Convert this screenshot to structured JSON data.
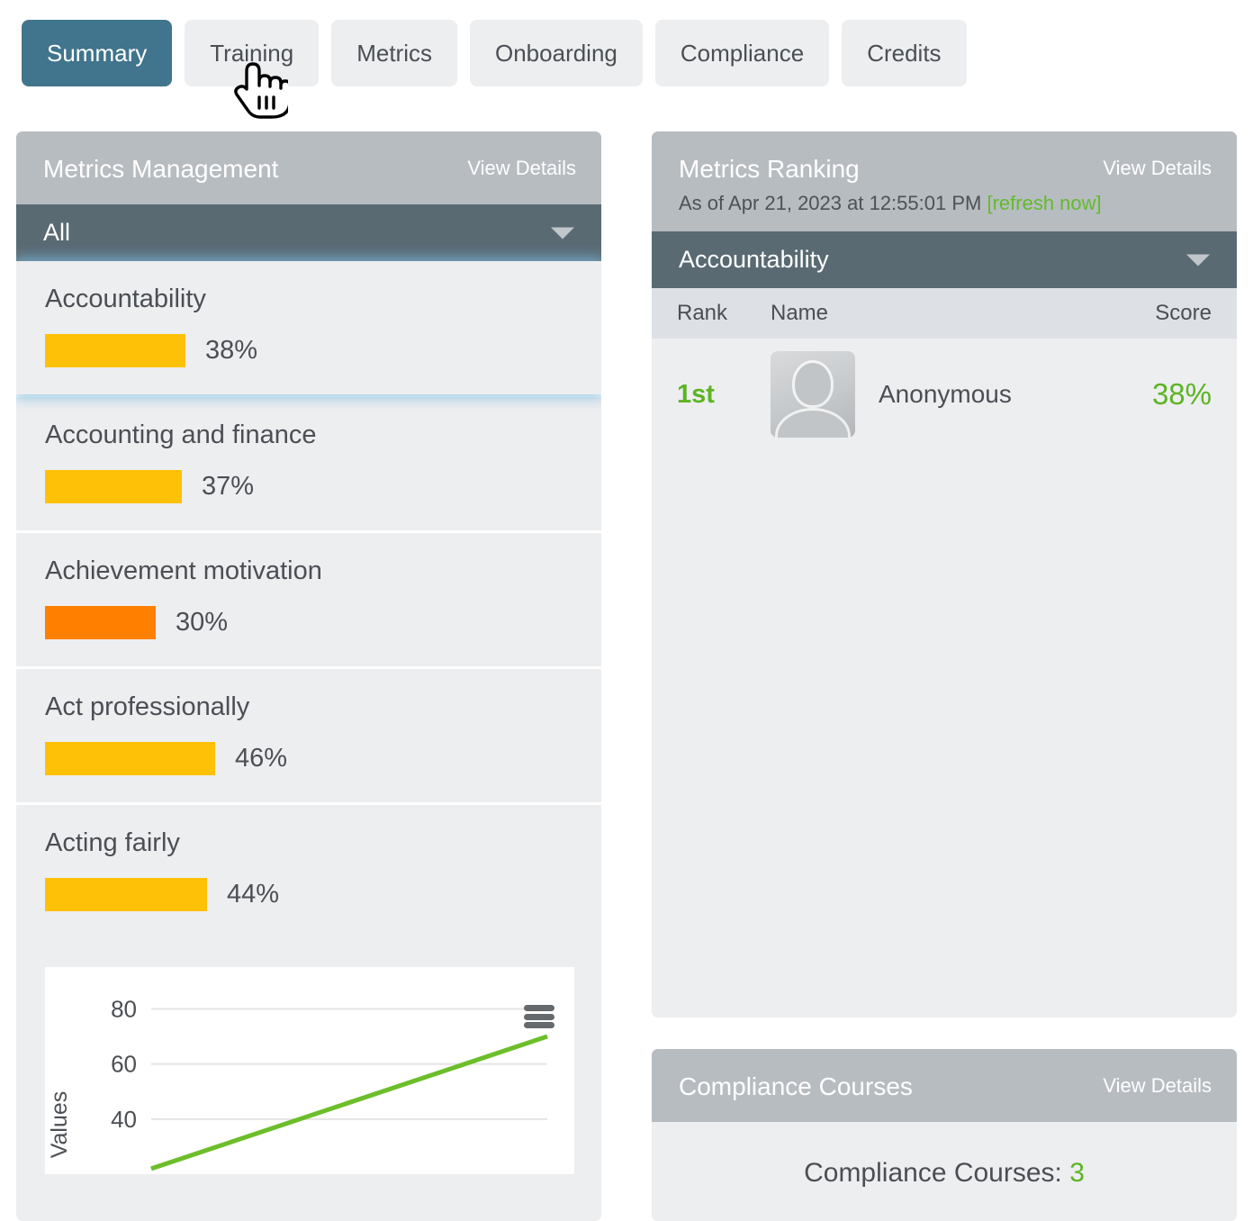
{
  "tabs": [
    {
      "label": "Summary",
      "active": true
    },
    {
      "label": "Training",
      "active": false
    },
    {
      "label": "Metrics",
      "active": false
    },
    {
      "label": "Onboarding",
      "active": false
    },
    {
      "label": "Compliance",
      "active": false
    },
    {
      "label": "Credits",
      "active": false
    }
  ],
  "cursor": {
    "icon": "pointing-hand-cursor",
    "over_tab": "Training"
  },
  "metrics_panel": {
    "title": "Metrics Management",
    "view_details": "View Details",
    "filter_value": "All",
    "items": [
      {
        "name": "Accountability",
        "pct_label": "38%",
        "pct": 38,
        "color": "#ffc107",
        "selected": true
      },
      {
        "name": "Accounting and finance",
        "pct_label": "37%",
        "pct": 37,
        "color": "#ffc107",
        "selected": false
      },
      {
        "name": "Achievement motivation",
        "pct_label": "30%",
        "pct": 30,
        "color": "#ff7f00",
        "selected": false
      },
      {
        "name": "Act professionally",
        "pct_label": "46%",
        "pct": 46,
        "color": "#ffc107",
        "selected": false
      },
      {
        "name": "Acting fairly",
        "pct_label": "44%",
        "pct": 44,
        "color": "#ffc107",
        "selected": false
      }
    ]
  },
  "ranking_panel": {
    "title": "Metrics Ranking",
    "view_details": "View Details",
    "as_of": "As of Apr 21, 2023 at 12:55:01 PM",
    "refresh_label": "[refresh now]",
    "filter_value": "Accountability",
    "columns": {
      "rank": "Rank",
      "name": "Name",
      "score": "Score"
    },
    "rows": [
      {
        "rank": "1st",
        "name": "Anonymous",
        "score": "38%",
        "avatar": "anonymous-avatar-icon"
      }
    ]
  },
  "courses_panel": {
    "title": "Compliance Courses",
    "view_details": "View Details",
    "summary_text": "Compliance Courses: ",
    "count": "3"
  },
  "chart_data": {
    "type": "line",
    "title": "",
    "xlabel": "",
    "ylabel": "Values",
    "yticks": [
      80,
      60,
      40
    ],
    "ylim": [
      20,
      88
    ],
    "grid": true,
    "legend": false,
    "menu_icon": "hamburger-menu-icon",
    "series": [
      {
        "name": "Values",
        "color": "#6cbe2a",
        "x": [
          0,
          1
        ],
        "values": [
          22,
          70
        ]
      }
    ]
  },
  "colors": {
    "accent_tab": "#41748d",
    "panel_header": "#b7bcc1",
    "select_bar": "#5a6a73",
    "bar_amber": "#ffc107",
    "bar_orange": "#ff7f00",
    "green": "#5cb423",
    "chart_line": "#6cbe2a"
  }
}
